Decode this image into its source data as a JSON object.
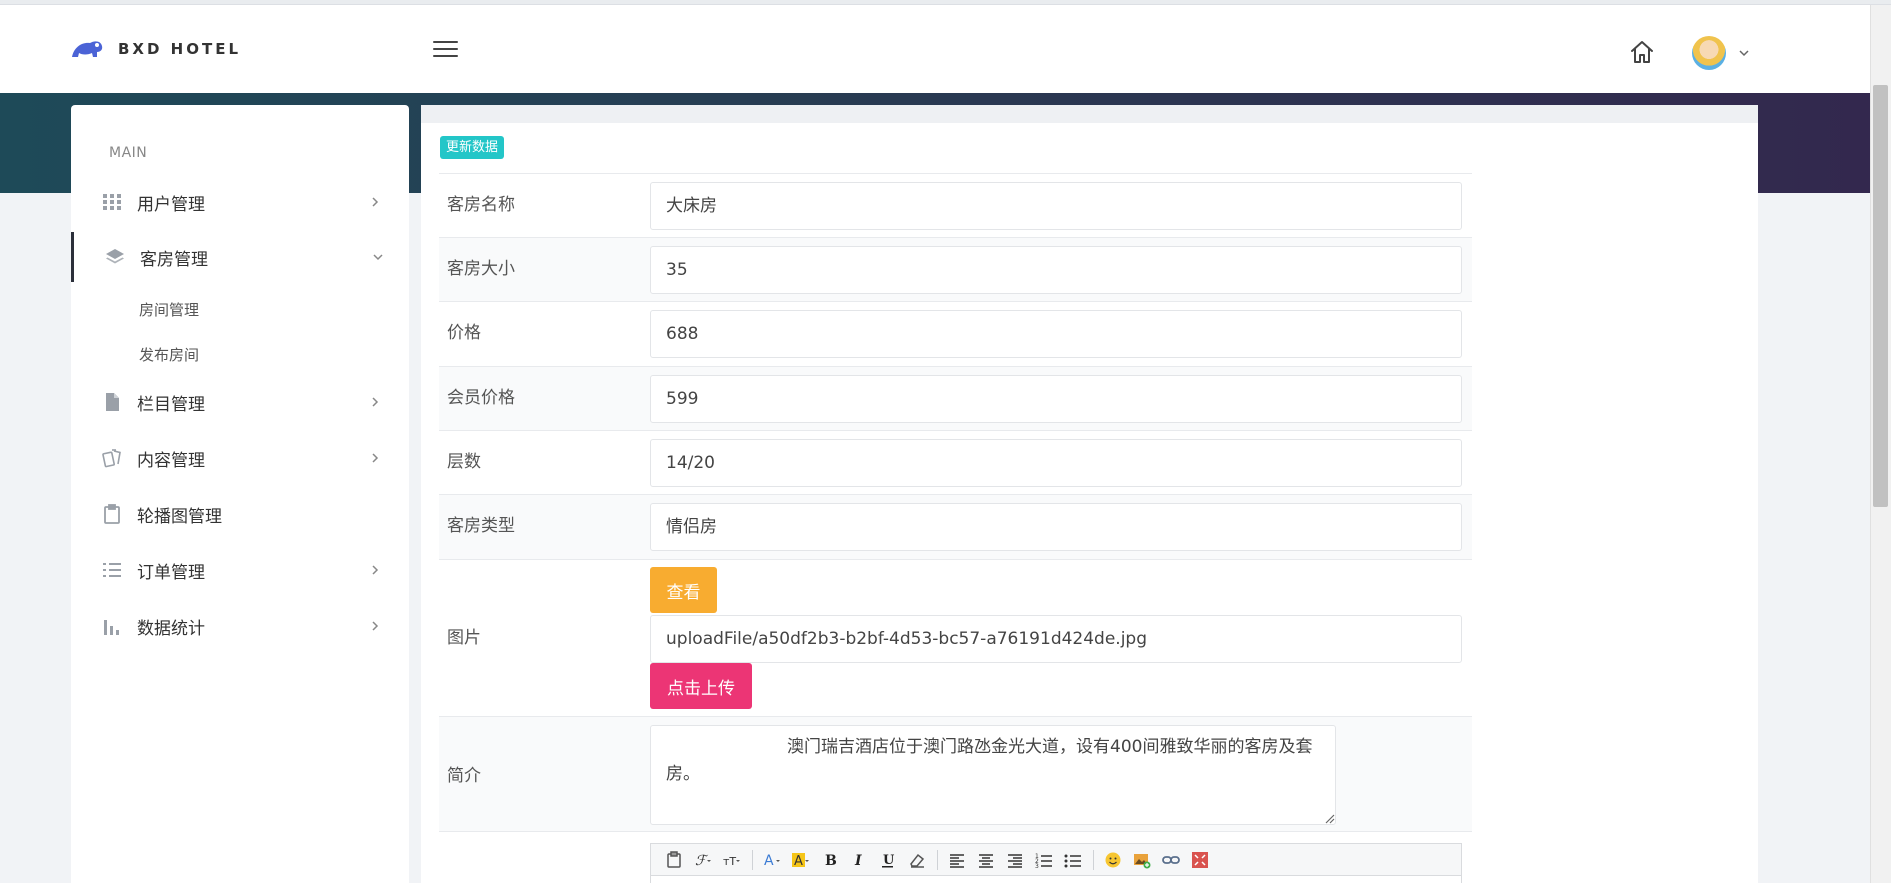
{
  "brand": {
    "name": "BXD HOTEL"
  },
  "sidebar": {
    "section": "MAIN",
    "items": [
      {
        "label": "用户管理",
        "icon": "grid-icon",
        "has_children": true
      },
      {
        "label": "客房管理",
        "icon": "layers-icon",
        "has_children": true,
        "expanded": true,
        "children": [
          {
            "label": "房间管理"
          },
          {
            "label": "发布房间"
          }
        ]
      },
      {
        "label": "栏目管理",
        "icon": "file-icon",
        "has_children": true
      },
      {
        "label": "内容管理",
        "icon": "cards-icon",
        "has_children": true
      },
      {
        "label": "轮播图管理",
        "icon": "clipboard-icon",
        "has_children": false
      },
      {
        "label": "订单管理",
        "icon": "list-icon",
        "has_children": true
      },
      {
        "label": "数据统计",
        "icon": "bar-chart-icon",
        "has_children": true
      }
    ]
  },
  "form": {
    "badge": "更新数据",
    "fields": {
      "room_name": {
        "label": "客房名称",
        "value": "大床房"
      },
      "room_size": {
        "label": "客房大小",
        "value": "35"
      },
      "price": {
        "label": "价格",
        "value": "688"
      },
      "member_price": {
        "label": "会员价格",
        "value": "599"
      },
      "floor": {
        "label": "层数",
        "value": "14/20"
      },
      "room_type": {
        "label": "客房类型",
        "value": "情侣房"
      },
      "image": {
        "label": "图片",
        "value": "uploadFile/a50df2b3-b2bf-4d53-bc57-a76191d424de.jpg",
        "view_label": "查看",
        "upload_label": "点击上传"
      },
      "intro": {
        "label": "简介",
        "value": "澳门瑞吉酒店位于澳门路氹金光大道，设有400间雅致华丽的客房及套房。"
      }
    }
  },
  "colors": {
    "badge": "#23c6c8",
    "view_button": "#f8ac30",
    "upload_button": "#ec3575",
    "banner_start": "#1e4a58",
    "banner_end": "#33284e"
  }
}
